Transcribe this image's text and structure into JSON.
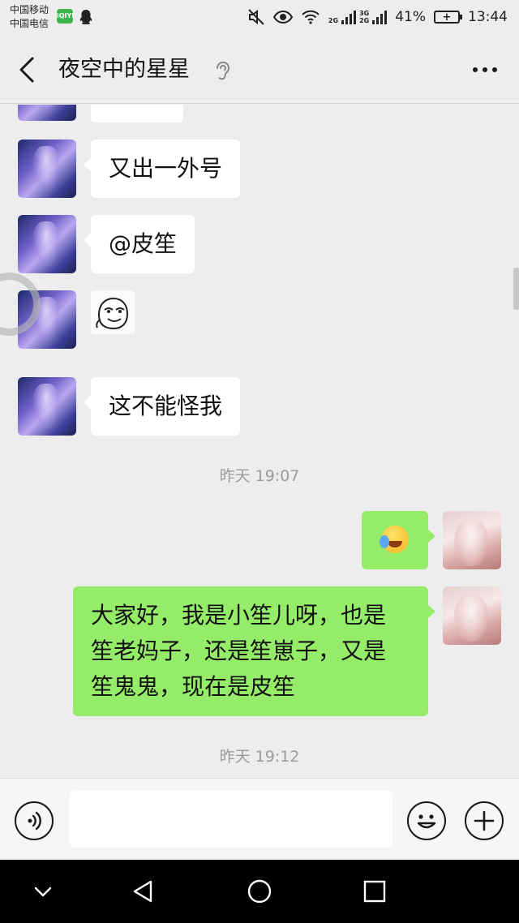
{
  "status_bar": {
    "carrier_1": "中国移动",
    "carrier_2": "中国电信",
    "net_1": "2G",
    "net_2": "3G",
    "net_3": "2G",
    "battery_percent": "41%",
    "time": "13:44",
    "icons": [
      "iqiyi-icon",
      "qq-icon",
      "mute-icon",
      "eye-icon",
      "wifi-icon",
      "signal-icon",
      "battery-icon"
    ]
  },
  "header": {
    "title": "夜空中的星星",
    "icons": [
      "back-icon",
      "ear-icon",
      "more-icon"
    ]
  },
  "messages": [
    {
      "side": "left",
      "type": "text",
      "text": "又出一外号"
    },
    {
      "side": "left",
      "type": "text",
      "text": "@皮笙"
    },
    {
      "side": "left",
      "type": "sticker",
      "sticker": "smirk-face-sticker"
    },
    {
      "side": "left",
      "type": "text",
      "text": "这不能怪我"
    },
    {
      "type": "time",
      "text": "昨天 19:07"
    },
    {
      "side": "right",
      "type": "emoji",
      "emoji": "laugh-cry-emoji"
    },
    {
      "side": "right",
      "type": "text",
      "lines": [
        "大家好，我是小笙儿呀，也是",
        "笙老妈子，还是笙崽子，又是",
        "笙鬼鬼，现在是皮笙"
      ]
    },
    {
      "type": "time",
      "text": "昨天 19:12"
    }
  ],
  "input_bar": {
    "icons": [
      "voice-icon",
      "emoji-icon",
      "plus-icon"
    ],
    "text_value": ""
  },
  "nav_bar": {
    "icons": [
      "collapse-icon",
      "back-triangle-icon",
      "home-circle-icon",
      "recents-square-icon"
    ]
  },
  "colors": {
    "background": "#ededed",
    "bubble_left": "#ffffff",
    "bubble_right": "#95ec69",
    "timestamp": "#9b9b9b"
  }
}
